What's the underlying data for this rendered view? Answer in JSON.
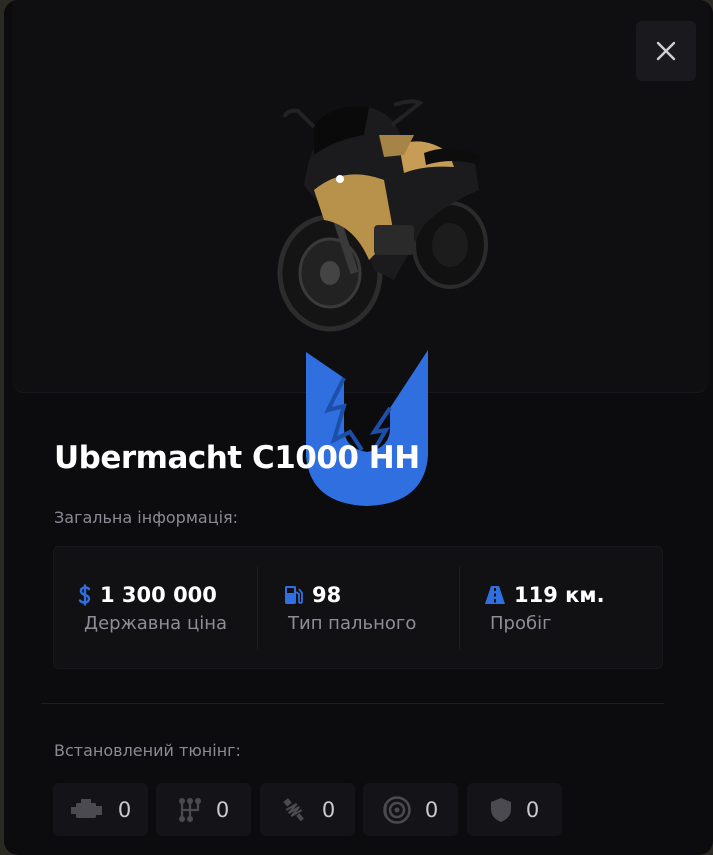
{
  "vehicle": {
    "name": "Ubermacht C1000 HH"
  },
  "sections": {
    "general_info": "Загальна інформація:",
    "installed_tuning": "Встановлений тюнінг:"
  },
  "info": [
    {
      "icon": "dollar-icon",
      "value": "1 300 000",
      "label": "Державна ціна"
    },
    {
      "icon": "fuel-pump-icon",
      "value": "98",
      "label": "Тип пального"
    },
    {
      "icon": "road-icon",
      "value": "119 км.",
      "label": "Пробіг"
    }
  ],
  "tuning": [
    {
      "icon": "engine-icon",
      "value": "0"
    },
    {
      "icon": "transmission-icon",
      "value": "0"
    },
    {
      "icon": "suspension-icon",
      "value": "0"
    },
    {
      "icon": "brakes-icon",
      "value": "0"
    },
    {
      "icon": "armor-icon",
      "value": "0"
    }
  ],
  "colors": {
    "accent": "#2f6fe0",
    "background": "#0c0c0f",
    "panel": "#111114",
    "text_primary": "#ffffff",
    "text_muted": "#8b8b93"
  }
}
